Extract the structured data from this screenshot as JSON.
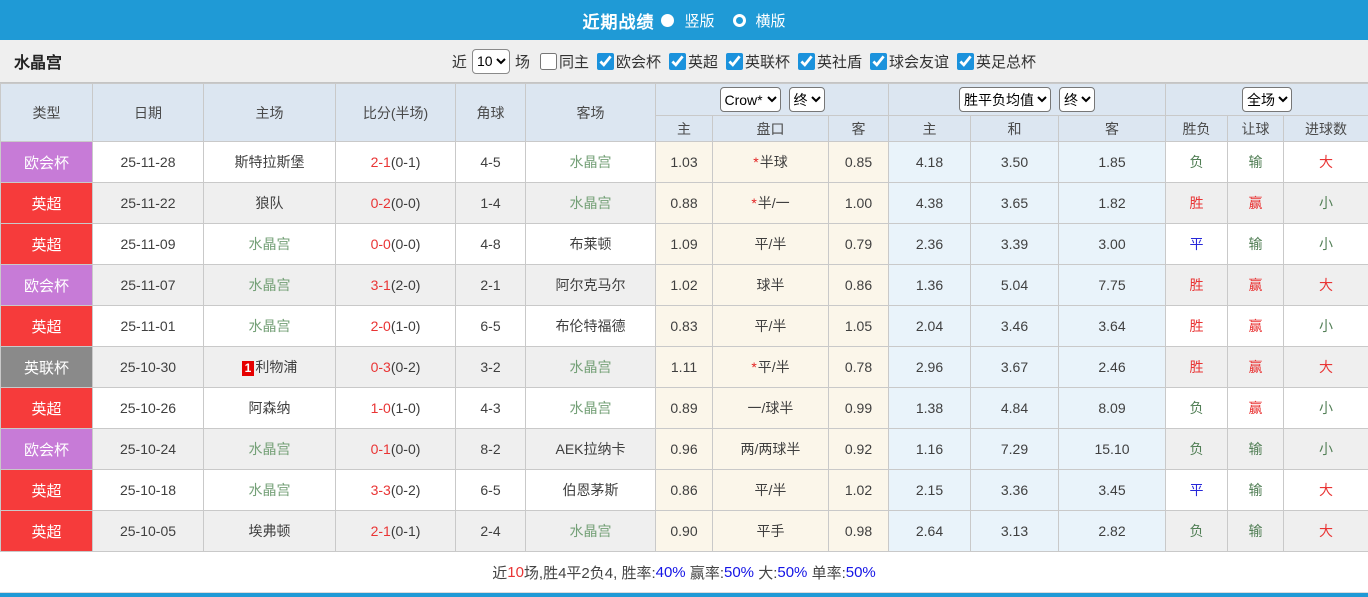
{
  "title_bar": {
    "title": "近期战绩",
    "modes": [
      {
        "label": "竖版",
        "selected": true
      },
      {
        "label": "横版",
        "selected": false
      }
    ]
  },
  "filters": {
    "team": "水晶宫",
    "recent_label": "近",
    "count_selected": "10",
    "games_label": "场",
    "same_host": {
      "label": "同主",
      "checked": false
    },
    "leagues": [
      {
        "label": "欧会杯",
        "checked": true
      },
      {
        "label": "英超",
        "checked": true
      },
      {
        "label": "英联杯",
        "checked": true
      },
      {
        "label": "英社盾",
        "checked": true
      },
      {
        "label": "球会友谊",
        "checked": true
      },
      {
        "label": "英足总杯",
        "checked": true
      }
    ]
  },
  "table": {
    "headers_main": [
      "类型",
      "日期",
      "主场",
      "比分(半场)",
      "角球",
      "客场"
    ],
    "headers_sub": [
      "主",
      "盘口",
      "客",
      "主",
      "和",
      "客",
      "胜负",
      "让球",
      "进球数"
    ],
    "selects": {
      "company": "Crow*",
      "company_period": "终",
      "avg": "胜平负均值",
      "avg_period": "终",
      "scope": "全场"
    },
    "rows": [
      {
        "league": "欧会杯",
        "league_color": "purple",
        "date": "25-11-28",
        "home": {
          "name": "斯特拉斯堡",
          "green": false
        },
        "score": {
          "ft": "2-1",
          "ht": "(0-1)"
        },
        "corner": "4-5",
        "away": {
          "name": "水晶宫",
          "green": true
        },
        "odds": {
          "home": "1.03",
          "star": true,
          "handicap": "半球",
          "away": "0.85"
        },
        "avg": {
          "home": "4.18",
          "draw": "3.50",
          "away": "1.85"
        },
        "result": {
          "text": "负",
          "color": "green"
        },
        "handicap_result": {
          "text": "输",
          "color": "green"
        },
        "goals": {
          "text": "大",
          "color": "red"
        }
      },
      {
        "league": "英超",
        "league_color": "red",
        "date": "25-11-22",
        "home": {
          "name": "狼队",
          "green": false
        },
        "score": {
          "ft": "0-2",
          "ht": "(0-0)"
        },
        "corner": "1-4",
        "away": {
          "name": "水晶宫",
          "green": true
        },
        "odds": {
          "home": "0.88",
          "star": true,
          "handicap": "半/一",
          "away": "1.00"
        },
        "avg": {
          "home": "4.38",
          "draw": "3.65",
          "away": "1.82"
        },
        "result": {
          "text": "胜",
          "color": "red"
        },
        "handicap_result": {
          "text": "赢",
          "color": "red"
        },
        "goals": {
          "text": "小",
          "color": "green"
        }
      },
      {
        "league": "英超",
        "league_color": "red",
        "date": "25-11-09",
        "home": {
          "name": "水晶宫",
          "green": true
        },
        "score": {
          "ft": "0-0",
          "ht": "(0-0)"
        },
        "corner": "4-8",
        "away": {
          "name": "布莱顿",
          "green": false
        },
        "odds": {
          "home": "1.09",
          "star": false,
          "handicap": "平/半",
          "away": "0.79"
        },
        "avg": {
          "home": "2.36",
          "draw": "3.39",
          "away": "3.00"
        },
        "result": {
          "text": "平",
          "color": "blue"
        },
        "handicap_result": {
          "text": "输",
          "color": "green"
        },
        "goals": {
          "text": "小",
          "color": "green"
        }
      },
      {
        "league": "欧会杯",
        "league_color": "purple",
        "date": "25-11-07",
        "home": {
          "name": "水晶宫",
          "green": true
        },
        "score": {
          "ft": "3-1",
          "ht": "(2-0)"
        },
        "corner": "2-1",
        "away": {
          "name": "阿尔克马尔",
          "green": false
        },
        "odds": {
          "home": "1.02",
          "star": false,
          "handicap": "球半",
          "away": "0.86"
        },
        "avg": {
          "home": "1.36",
          "draw": "5.04",
          "away": "7.75"
        },
        "result": {
          "text": "胜",
          "color": "red"
        },
        "handicap_result": {
          "text": "赢",
          "color": "red"
        },
        "goals": {
          "text": "大",
          "color": "red"
        }
      },
      {
        "league": "英超",
        "league_color": "red",
        "date": "25-11-01",
        "home": {
          "name": "水晶宫",
          "green": true
        },
        "score": {
          "ft": "2-0",
          "ht": "(1-0)"
        },
        "corner": "6-5",
        "away": {
          "name": "布伦特福德",
          "green": false
        },
        "odds": {
          "home": "0.83",
          "star": false,
          "handicap": "平/半",
          "away": "1.05"
        },
        "avg": {
          "home": "2.04",
          "draw": "3.46",
          "away": "3.64"
        },
        "result": {
          "text": "胜",
          "color": "red"
        },
        "handicap_result": {
          "text": "赢",
          "color": "red"
        },
        "goals": {
          "text": "小",
          "color": "green"
        }
      },
      {
        "league": "英联杯",
        "league_color": "gray",
        "date": "25-10-30",
        "home": {
          "name": "利物浦",
          "green": false,
          "rank": "1"
        },
        "score": {
          "ft": "0-3",
          "ht": "(0-2)"
        },
        "corner": "3-2",
        "away": {
          "name": "水晶宫",
          "green": true
        },
        "odds": {
          "home": "1.11",
          "star": true,
          "handicap": "平/半",
          "away": "0.78"
        },
        "avg": {
          "home": "2.96",
          "draw": "3.67",
          "away": "2.46"
        },
        "result": {
          "text": "胜",
          "color": "red"
        },
        "handicap_result": {
          "text": "赢",
          "color": "red"
        },
        "goals": {
          "text": "大",
          "color": "red"
        }
      },
      {
        "league": "英超",
        "league_color": "red",
        "date": "25-10-26",
        "home": {
          "name": "阿森纳",
          "green": false
        },
        "score": {
          "ft": "1-0",
          "ht": "(1-0)"
        },
        "corner": "4-3",
        "away": {
          "name": "水晶宫",
          "green": true
        },
        "odds": {
          "home": "0.89",
          "star": false,
          "handicap": "一/球半",
          "away": "0.99"
        },
        "avg": {
          "home": "1.38",
          "draw": "4.84",
          "away": "8.09"
        },
        "result": {
          "text": "负",
          "color": "green"
        },
        "handicap_result": {
          "text": "赢",
          "color": "red"
        },
        "goals": {
          "text": "小",
          "color": "green"
        }
      },
      {
        "league": "欧会杯",
        "league_color": "purple",
        "date": "25-10-24",
        "home": {
          "name": "水晶宫",
          "green": true
        },
        "score": {
          "ft": "0-1",
          "ht": "(0-0)"
        },
        "corner": "8-2",
        "away": {
          "name": "AEK拉纳卡",
          "green": false
        },
        "odds": {
          "home": "0.96",
          "star": false,
          "handicap": "两/两球半",
          "away": "0.92"
        },
        "avg": {
          "home": "1.16",
          "draw": "7.29",
          "away": "15.10"
        },
        "result": {
          "text": "负",
          "color": "green"
        },
        "handicap_result": {
          "text": "输",
          "color": "green"
        },
        "goals": {
          "text": "小",
          "color": "green"
        }
      },
      {
        "league": "英超",
        "league_color": "red",
        "date": "25-10-18",
        "home": {
          "name": "水晶宫",
          "green": true
        },
        "score": {
          "ft": "3-3",
          "ht": "(0-2)"
        },
        "corner": "6-5",
        "away": {
          "name": "伯恩茅斯",
          "green": false
        },
        "odds": {
          "home": "0.86",
          "star": false,
          "handicap": "平/半",
          "away": "1.02"
        },
        "avg": {
          "home": "2.15",
          "draw": "3.36",
          "away": "3.45"
        },
        "result": {
          "text": "平",
          "color": "blue"
        },
        "handicap_result": {
          "text": "输",
          "color": "green"
        },
        "goals": {
          "text": "大",
          "color": "red"
        }
      },
      {
        "league": "英超",
        "league_color": "red",
        "date": "25-10-05",
        "home": {
          "name": "埃弗顿",
          "green": false
        },
        "score": {
          "ft": "2-1",
          "ht": "(0-1)"
        },
        "corner": "2-4",
        "away": {
          "name": "水晶宫",
          "green": true
        },
        "odds": {
          "home": "0.90",
          "star": false,
          "handicap": "平手",
          "away": "0.98"
        },
        "avg": {
          "home": "2.64",
          "draw": "3.13",
          "away": "2.82"
        },
        "result": {
          "text": "负",
          "color": "green"
        },
        "handicap_result": {
          "text": "输",
          "color": "green"
        },
        "goals": {
          "text": "大",
          "color": "red"
        }
      }
    ]
  },
  "footer": {
    "segments": [
      {
        "t": "近",
        "c": "dark"
      },
      {
        "t": "10",
        "c": "red"
      },
      {
        "t": "场,胜4平2负4, ",
        "c": "dark"
      },
      {
        "t": "胜率:",
        "c": "dark"
      },
      {
        "t": "40%",
        "c": "blue"
      },
      {
        "t": " 赢率:",
        "c": "dark"
      },
      {
        "t": "50%",
        "c": "blue"
      },
      {
        "t": " 大:",
        "c": "dark"
      },
      {
        "t": "50%",
        "c": "blue"
      },
      {
        "t": " 单率:",
        "c": "dark"
      },
      {
        "t": "50%",
        "c": "blue"
      }
    ]
  },
  "colors": {
    "header_blue": "#1f9ad6",
    "league": {
      "purple": "#c77bd7",
      "red": "#f63b3b",
      "gray": "#8a8a8a"
    },
    "status": {
      "red": "#e93434",
      "green": "#527f56",
      "blue": "#2727d9",
      "dark": "#3c3c3c"
    },
    "team_green": "#74a077",
    "team_dark": "#3f3f3f",
    "footer_colors": {
      "dark": "#444444",
      "red": "#e93434",
      "blue": "#1414e6"
    }
  }
}
